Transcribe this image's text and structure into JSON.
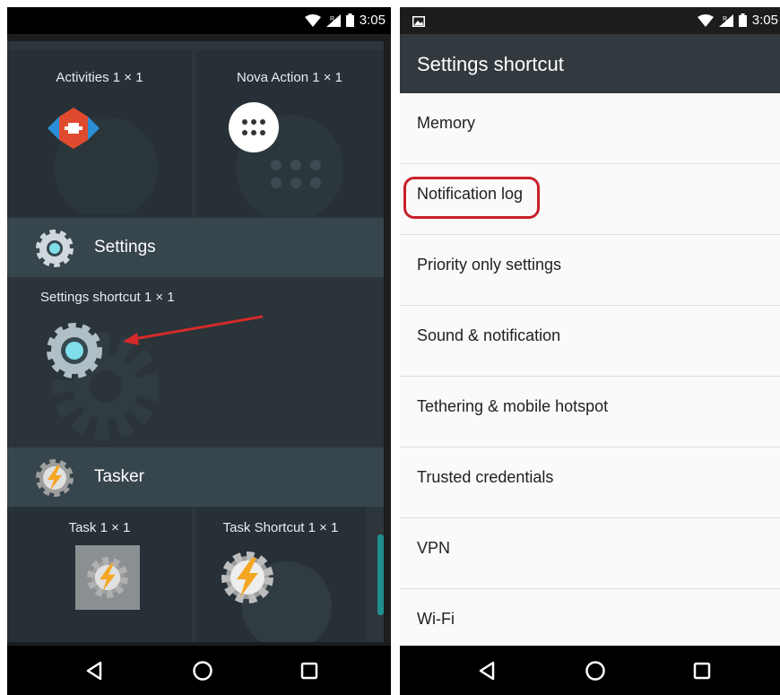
{
  "status_bar": {
    "time": "3:05"
  },
  "left_panel": {
    "widgets_top": [
      {
        "title": "Activities",
        "size": "1 × 1"
      },
      {
        "title": "Nova Action",
        "size": "1 × 1"
      }
    ],
    "settings_section": {
      "title": "Settings"
    },
    "settings_widget": {
      "title": "Settings shortcut",
      "size": "1 × 1"
    },
    "tasker_section": {
      "title": "Tasker"
    },
    "widgets_bottom": [
      {
        "title": "Task",
        "size": "1 × 1"
      },
      {
        "title": "Task Shortcut",
        "size": "1 × 1"
      }
    ]
  },
  "right_panel": {
    "title": "Settings shortcut",
    "items": [
      {
        "label": "Memory"
      },
      {
        "label": "Notification log"
      },
      {
        "label": "Priority only settings"
      },
      {
        "label": "Sound & notification"
      },
      {
        "label": "Tethering & mobile hotspot"
      },
      {
        "label": "Trusted credentials"
      },
      {
        "label": "VPN"
      },
      {
        "label": "Wi-Fi"
      }
    ]
  },
  "colors": {
    "accent_teal": "#1f8e8e",
    "highlight_red": "#c8202a",
    "arrow_red": "#d42a2a"
  }
}
